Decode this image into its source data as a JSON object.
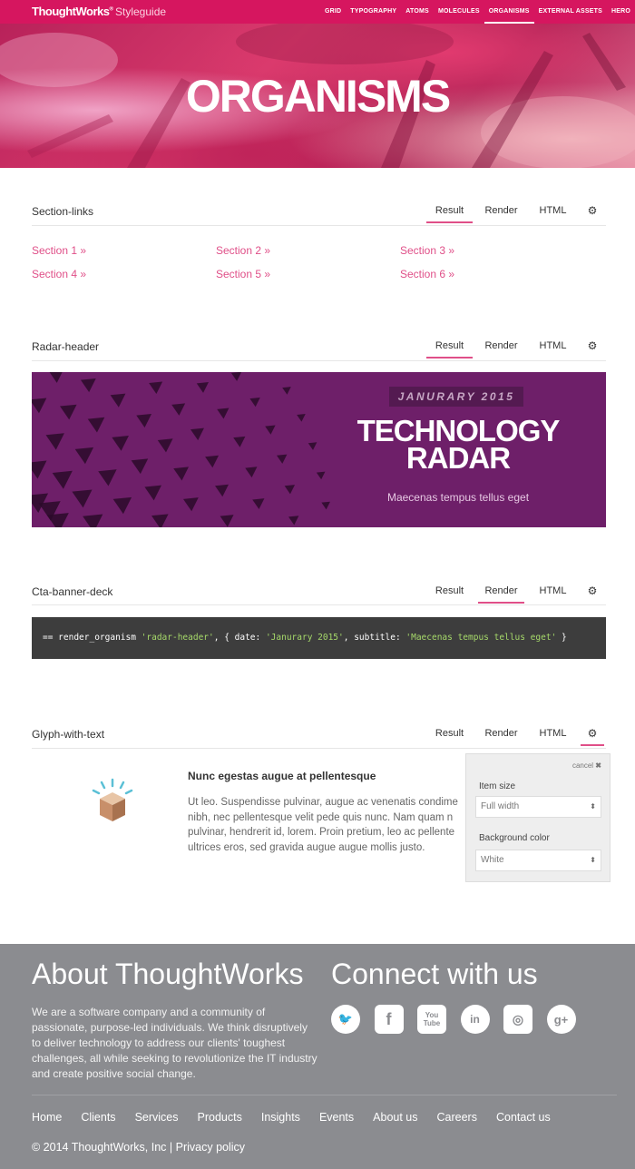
{
  "header": {
    "logo": "ThoughtWorks",
    "logo_mark": "®",
    "subtitle": "Styleguide",
    "nav": [
      "GRID",
      "TYPOGRAPHY",
      "ATOMS",
      "MOLECULES",
      "ORGANISMS",
      "EXTERNAL ASSETS",
      "HERO"
    ],
    "active_nav": "ORGANISMS"
  },
  "hero": {
    "title": "ORGANISMS"
  },
  "tabs": {
    "result": "Result",
    "render": "Render",
    "html": "HTML"
  },
  "sections": {
    "section_links": {
      "title": "Section-links",
      "links": [
        "Section 1 »",
        "Section 2 »",
        "Section 3 »",
        "Section 4 »",
        "Section 5 »",
        "Section 6 »"
      ]
    },
    "radar_header": {
      "title": "Radar-header",
      "date": "JANURARY 2015",
      "headline1": "TECHNOLOGY",
      "headline2": "RADAR",
      "subtitle": "Maecenas tempus tellus eget"
    },
    "cta_banner_deck": {
      "title": "Cta-banner-deck",
      "code_prefix": "== render_organism ",
      "code_arg1": "'radar-header'",
      "code_mid1": ", { date: ",
      "code_arg2": "'Janurary 2015'",
      "code_mid2": ", subtitle: ",
      "code_arg3": "'Maecenas tempus tellus eget'",
      "code_suffix": " }"
    },
    "glyph_with_text": {
      "title": "Glyph-with-text",
      "heading": "Nunc egestas augue at pellentesque",
      "lines": [
        "Ut leo. Suspendisse pulvinar, augue ac venenatis condime",
        "nibh, nec pellentesque velit pede quis nunc. Nam quam n",
        "pulvinar, hendrerit id, lorem. Proin pretium, leo ac pellente",
        "ultrices eros, sed gravida augue augue mollis justo."
      ],
      "panel": {
        "cancel": "cancel",
        "item_size_label": "Item size",
        "item_size_value": "Full width",
        "bg_color_label": "Background color",
        "bg_color_value": "White"
      }
    }
  },
  "footer": {
    "about_title": "About ThoughtWorks",
    "about_text": "We are a software company and a community of passionate, purpose-led individuals. We think disruptively to deliver technology to address our clients' toughest challenges, all while seeking to revolutionize the IT industry and create positive social change.",
    "connect_title": "Connect with us",
    "social": [
      "twitter-icon",
      "facebook-icon",
      "youtube-icon",
      "linkedin-icon",
      "weibo-icon",
      "google-plus-icon"
    ],
    "nav": [
      "Home",
      "Clients",
      "Services",
      "Products",
      "Insights",
      "Events",
      "About us",
      "Careers",
      "Contact us"
    ],
    "copyright": "© 2014 ThoughtWorks, Inc",
    "privacy": "Privacy policy"
  },
  "colors": {
    "brand": "#d6165f",
    "link": "#e04f88",
    "radar_bg": "#6e1f69",
    "footer_bg": "#8b8c90"
  }
}
